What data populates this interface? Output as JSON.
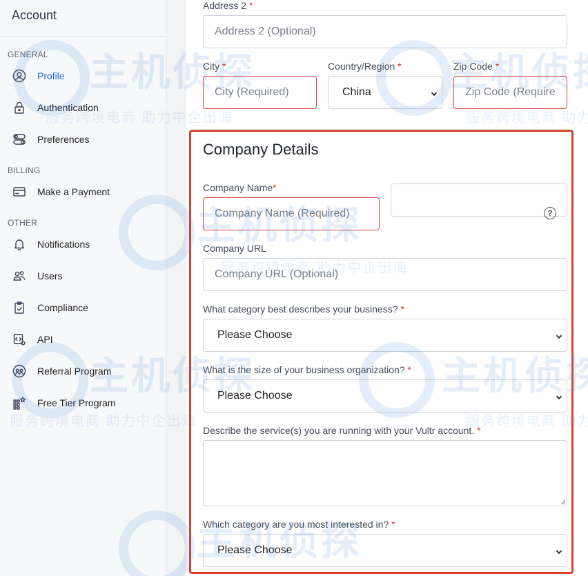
{
  "sidebar": {
    "title": "Account",
    "sections": [
      {
        "label": "GENERAL"
      },
      {
        "label": "BILLING"
      },
      {
        "label": "OTHER"
      }
    ],
    "items": [
      {
        "label": "Profile",
        "icon": "user-circle-icon",
        "active": true
      },
      {
        "label": "Authentication",
        "icon": "lock-icon"
      },
      {
        "label": "Preferences",
        "icon": "toggle-icon"
      },
      {
        "label": "Make a Payment",
        "icon": "credit-card-icon"
      },
      {
        "label": "Notifications",
        "icon": "bell-icon"
      },
      {
        "label": "Users",
        "icon": "users-icon"
      },
      {
        "label": "Compliance",
        "icon": "clipboard-check-icon"
      },
      {
        "label": "API",
        "icon": "code-file-icon"
      },
      {
        "label": "Referral Program",
        "icon": "referral-icon"
      },
      {
        "label": "Free Tier Program",
        "icon": "grid-star-icon"
      }
    ]
  },
  "address": {
    "address2_label": "Address 2",
    "address2_placeholder": "Address 2 (Optional)",
    "city_label": "City",
    "city_placeholder": "City (Required)",
    "country_label": "Country/Region",
    "country_value": "China",
    "zip_label": "Zip Code",
    "zip_placeholder": "Zip Code (Require"
  },
  "company": {
    "title": "Company Details",
    "name_label": "Company Name",
    "name_placeholder": "Company Name (Required)",
    "help_glyph": "?",
    "url_label": "Company URL",
    "url_placeholder": "Company URL (Optional)",
    "category_label": "What category best describes your business?",
    "category_value": "Please Choose",
    "size_label": "What is the size of your business organization?",
    "size_value": "Please Choose",
    "services_label": "Describe the service(s) you are running with your Vultr account.",
    "interest_label": "Which category are you most interested in?",
    "interest_value": "Please Choose"
  },
  "required_mark": "*",
  "watermark": {
    "brand": "主机侦探",
    "slogan": "服务跨境电商 助力中企出海"
  },
  "colors": {
    "accent": "#1e6fd9",
    "error": "#d9473f",
    "highlight": "#d7412d"
  }
}
